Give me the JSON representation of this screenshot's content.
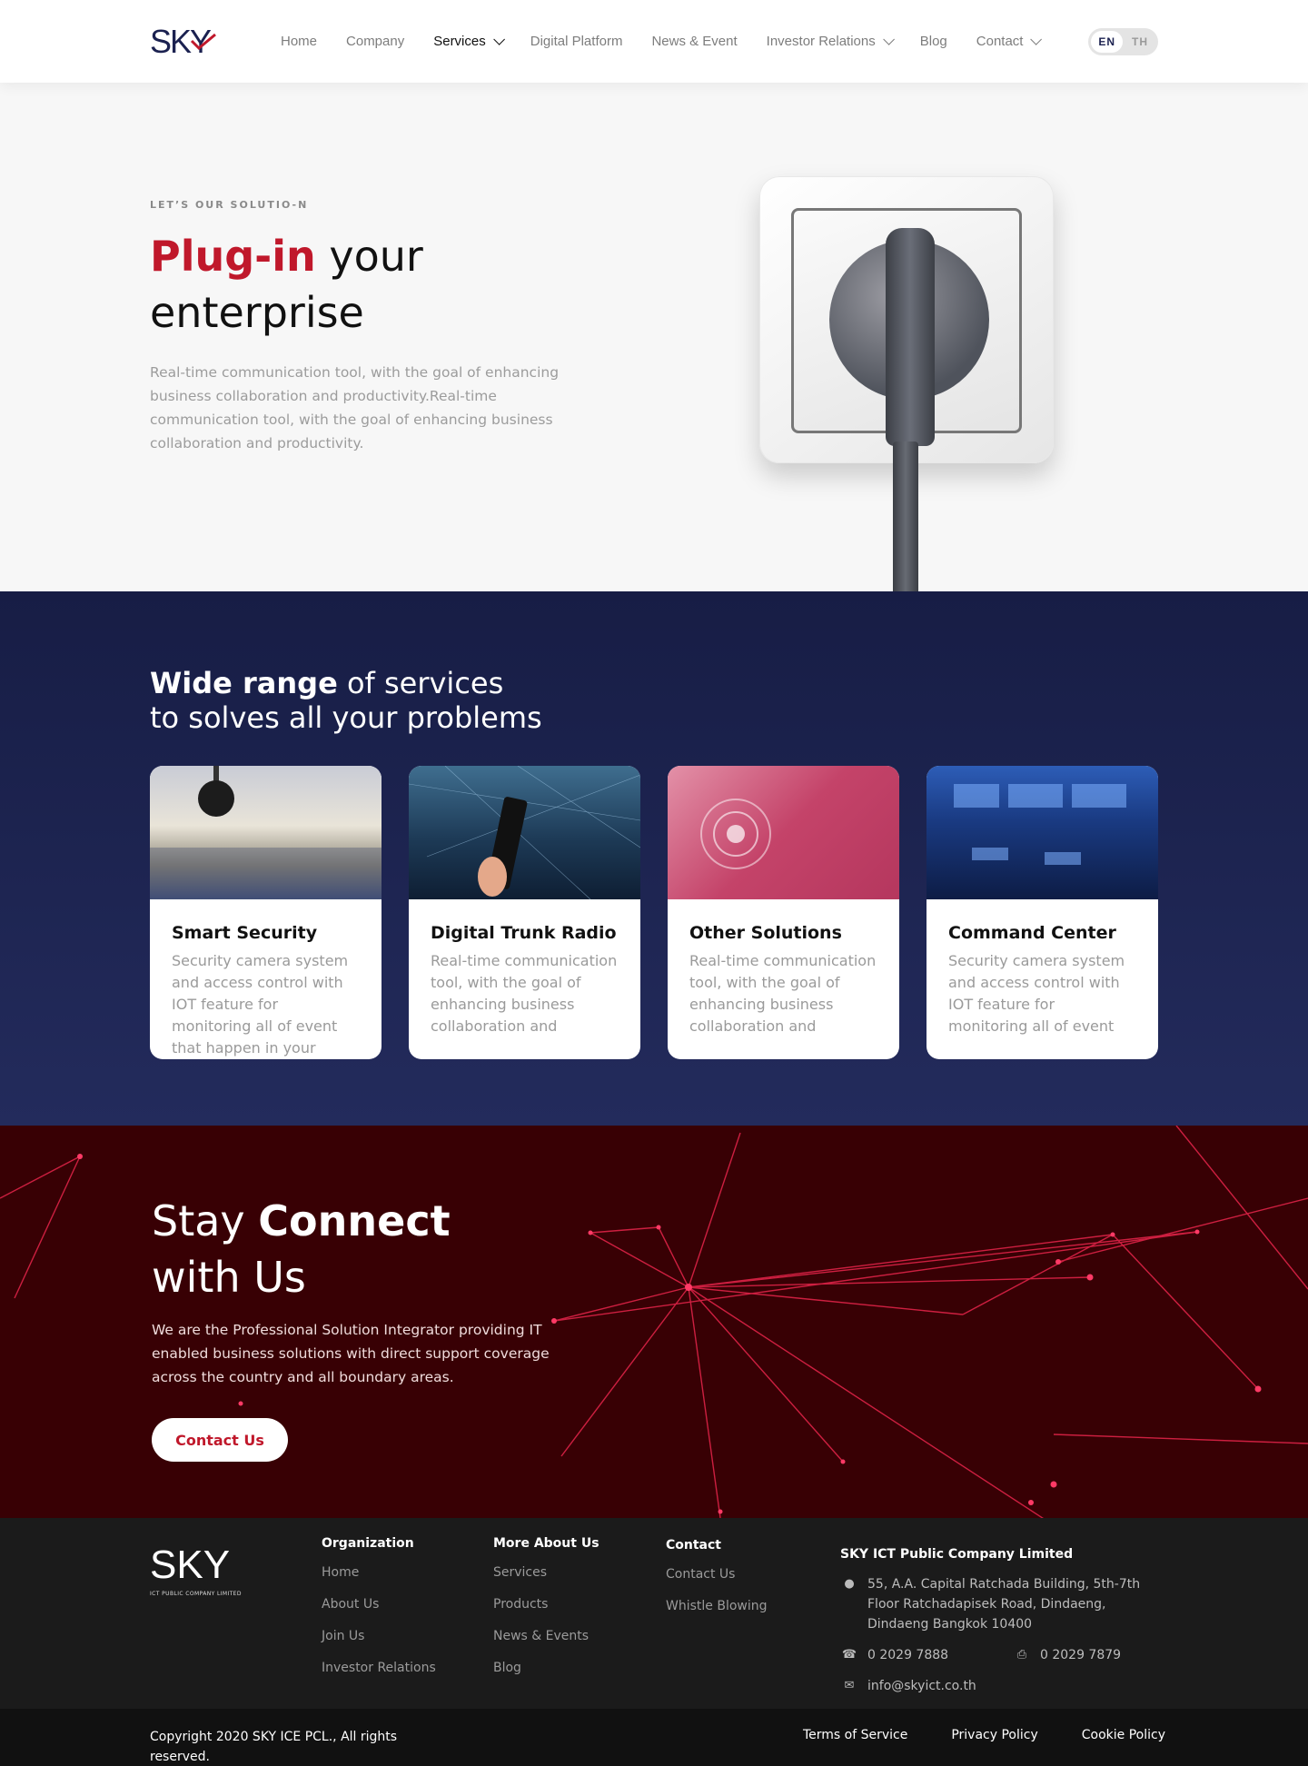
{
  "header": {
    "logo_text": "SKY",
    "nav": [
      {
        "label": "Home",
        "active": false,
        "dropdown": false
      },
      {
        "label": "Company",
        "active": false,
        "dropdown": false
      },
      {
        "label": "Services",
        "active": true,
        "dropdown": true
      },
      {
        "label": "Digital Platform",
        "active": false,
        "dropdown": false
      },
      {
        "label": "News & Event",
        "active": false,
        "dropdown": false
      },
      {
        "label": "Investor Relations",
        "active": false,
        "dropdown": true
      },
      {
        "label": "Blog",
        "active": false,
        "dropdown": false
      },
      {
        "label": "Contact",
        "active": false,
        "dropdown": true
      }
    ],
    "lang": {
      "en": "EN",
      "th": "TH",
      "selected": "EN"
    }
  },
  "hero": {
    "eyebrow": "LET’S OUR SOLUTIO-N",
    "title_highlight": "Plug-in",
    "title_rest_1": "your",
    "title_rest_2": "enterprise",
    "description": "Real-time communication tool, with the goal of enhancing business collaboration and productivity.Real-time communication tool, with the goal of enhancing business collaboration and productivity."
  },
  "services": {
    "title_bold": "Wide range",
    "title_rest": "of services",
    "title_line2": "to solves all your problems",
    "cards": [
      {
        "title": "Smart Security",
        "text": "Security camera system and access control with IOT feature for monitoring all of event that happen in your"
      },
      {
        "title": "Digital Trunk Radio",
        "text": "Real-time communication tool, with the goal of enhancing business collaboration and"
      },
      {
        "title": "Other Solutions",
        "text": "Real-time communication tool, with the goal of enhancing business collaboration and"
      },
      {
        "title": "Command Center",
        "text": "Security camera system and access control with IOT feature for monitoring all of event that happen"
      }
    ]
  },
  "connect": {
    "title_light": "Stay",
    "title_bold": "Connect",
    "title_line2": "with Us",
    "description": "We are the Professional Solution Integrator providing IT enabled business solutions with direct support coverage across the country and all boundary areas.",
    "button": "Contact Us"
  },
  "footer": {
    "logo_text": "SKY",
    "logo_sub": "ICT PUBLIC COMPANY LIMITED",
    "columns": [
      {
        "title": "Organization",
        "links": [
          "Home",
          "About Us",
          "Join Us",
          "Investor Relations"
        ]
      },
      {
        "title": "More About Us",
        "links": [
          "Services",
          "Products",
          "News & Events",
          "Blog"
        ]
      },
      {
        "title": "Contact",
        "links": [
          "Contact Us",
          "Whistle Blowing"
        ]
      }
    ],
    "company": {
      "name": "SKY ICT Public Company Limited",
      "address": "55, A.A. Capital Ratchada Building, 5th-7th Floor Ratchadapisek Road, Dindaeng, Dindaeng Bangkok 10400",
      "phone": "0 2029 7888",
      "fax": "0 2029 7879",
      "email": "info@skyict.co.th"
    },
    "copyright": "Copyright 2020 SKY ICE PCL., All rights reserved.",
    "legal": [
      "Terms of Service",
      "Privacy Policy",
      "Cookie Policy"
    ]
  },
  "colors": {
    "brand_red": "#c0182b",
    "brand_navy": "#1b2150",
    "connect_bg": "#380004"
  }
}
